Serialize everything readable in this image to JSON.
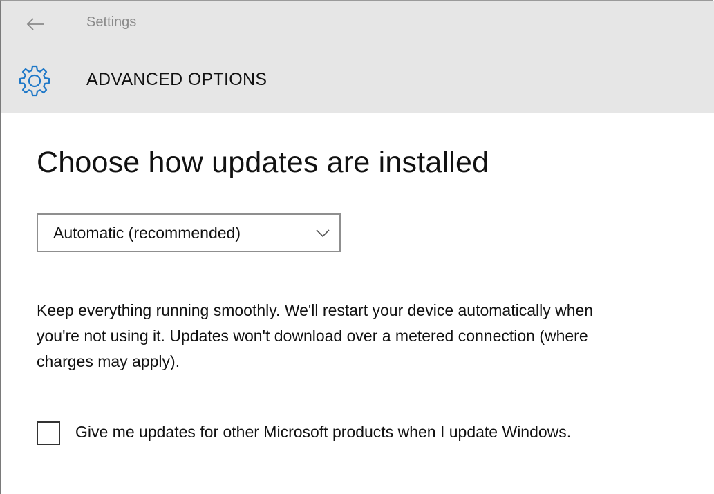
{
  "window": {
    "title": "Settings"
  },
  "header": {
    "title": "ADVANCED OPTIONS",
    "icon": "gear-icon",
    "accent_color": "#1e78c8"
  },
  "main": {
    "heading": "Choose how updates are installed",
    "install_mode": {
      "selected": "Automatic (recommended)"
    },
    "description": "Keep everything running smoothly. We'll restart your device automatically when you're not using it. Updates won't download over a metered connection (where charges may apply).",
    "other_products_checkbox": {
      "label": "Give me updates for other Microsoft products when I update Windows.",
      "checked": false
    }
  }
}
